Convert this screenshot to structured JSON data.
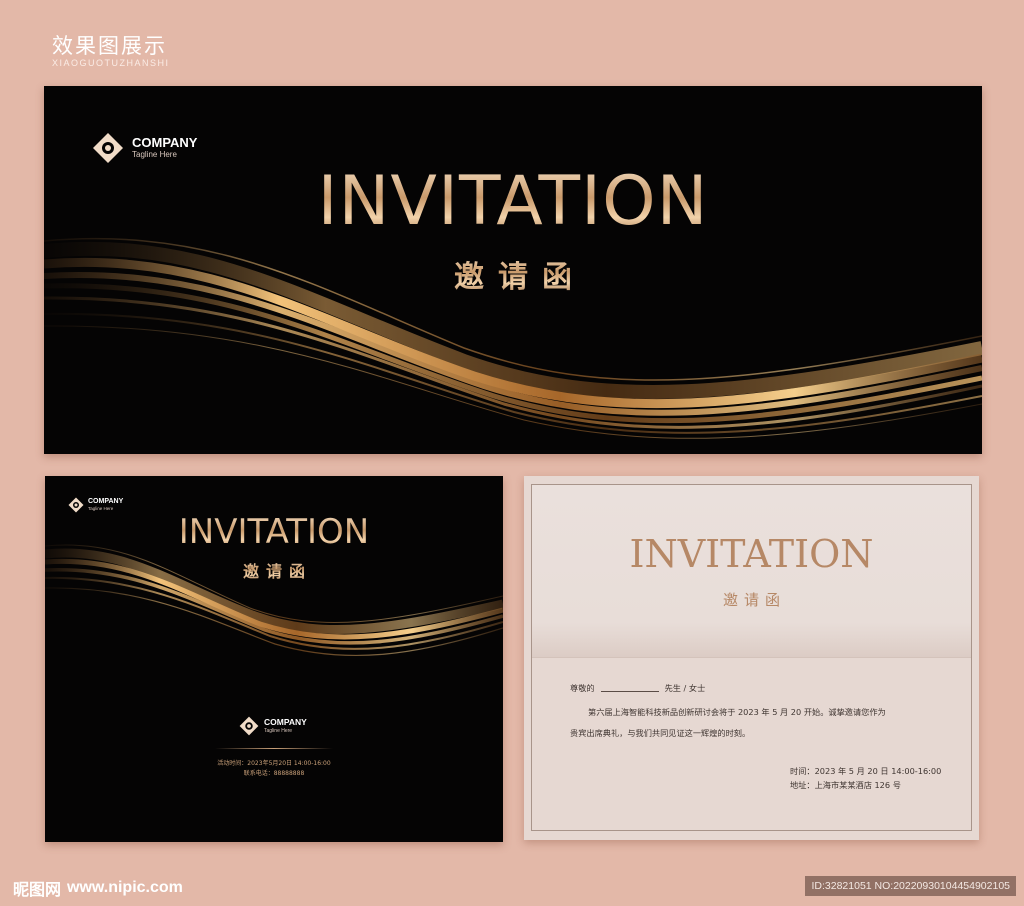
{
  "header": {
    "title": "效果图展示",
    "subtitle": "XIAOGUOTUZHANSHI"
  },
  "colors": {
    "background": "#e3b8a8",
    "card_dark": "#050404",
    "gold": "#c9a079",
    "letter_paper": "#e6d8d2",
    "letter_title": "#b68866"
  },
  "top_card": {
    "logo": {
      "icon": "company-diamond-logo-icon",
      "name": "COMPANY",
      "tagline": "Tagline Here"
    },
    "title": "INVITATION",
    "title_cn": "邀请函"
  },
  "cover_card": {
    "logo": {
      "icon": "company-diamond-logo-icon",
      "name": "COMPANY",
      "tagline": "Tagline Here"
    },
    "title": "INVITATION",
    "title_cn": "邀请函",
    "bottom_logo": {
      "icon": "company-diamond-logo-icon",
      "name": "COMPANY",
      "tagline": "Tagline Here"
    },
    "event_time": "活动时间：2023年5月20日 14:00-16:00",
    "contact": "联系电话：88888888"
  },
  "letter_card": {
    "title": "INVITATION",
    "title_cn": "邀请函",
    "salutation_prefix": "尊敬的",
    "salutation_suffix": "先生 / 女士",
    "body_line1": "第六届上海智能科技新品创新研讨会将于 2023 年 5 月 20 开始。诚挚邀请您作为",
    "body_line2": "贵宾出席典礼，与我们共同见证这一辉煌的时刻。",
    "time": "时间：2023 年 5 月 20 日 14:00-16:00",
    "address": "地址：上海市某某酒店 126 号"
  },
  "footer": {
    "site_name": "昵图网",
    "url": "www.nipic.com",
    "image_id": "ID:32821051 NO:20220930104454902105"
  }
}
